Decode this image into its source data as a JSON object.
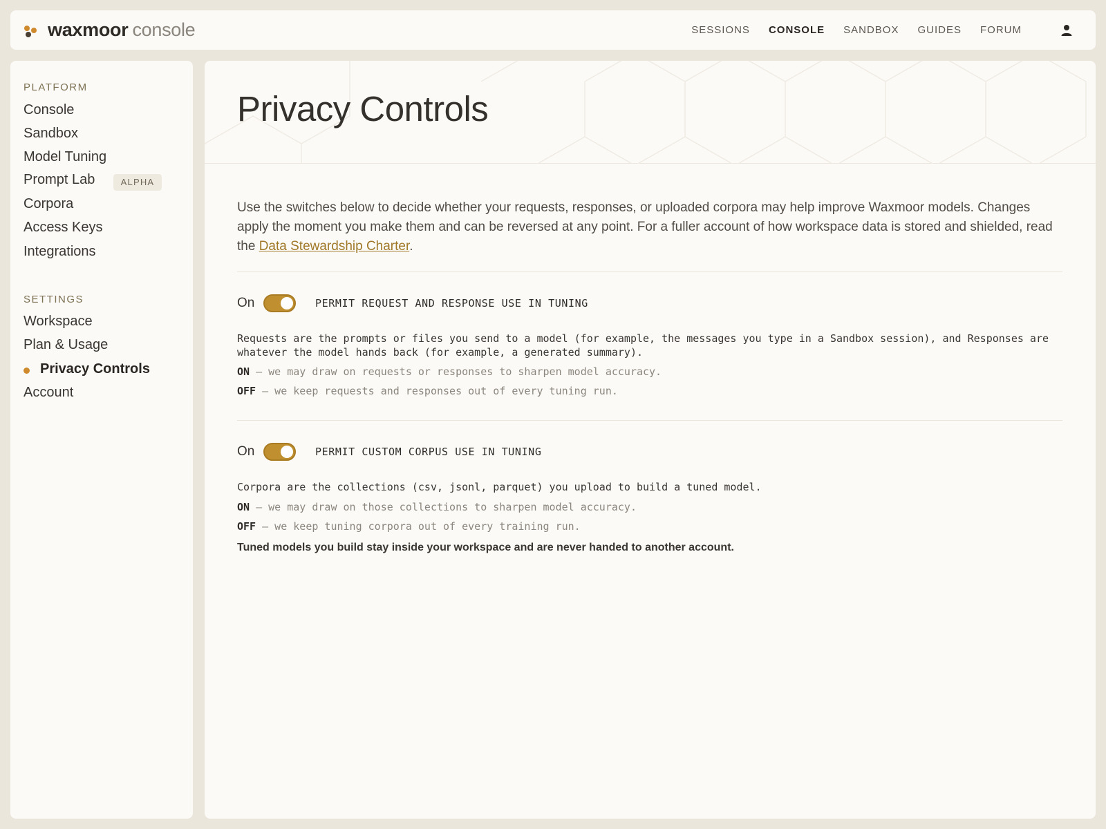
{
  "brand": {
    "name": "waxmoor",
    "suffix": "console"
  },
  "nav": {
    "items": [
      "SESSIONS",
      "CONSOLE",
      "SANDBOX",
      "GUIDES",
      "FORUM"
    ],
    "active": "CONSOLE",
    "user_icon": "user-icon"
  },
  "sidebar": {
    "platform_title": "PLATFORM",
    "platform_items": [
      "Console",
      "Sandbox",
      "Model Tuning",
      "Prompt Lab",
      "Corpora",
      "Access Keys",
      "Integrations"
    ],
    "prompt_lab_badge": "ALPHA",
    "settings_title": "SETTINGS",
    "settings_items": [
      "Workspace",
      "Plan & Usage",
      "Privacy Controls",
      "Account"
    ],
    "active_item": "Privacy Controls"
  },
  "page": {
    "title": "Privacy Controls",
    "intro_text": "Use the switches below to decide whether your requests, responses, or uploaded corpora may help improve Waxmoor models. Changes apply the moment you make them and can be reversed at any point. For a fuller account of how workspace data is stored and shielded, read the ",
    "intro_link": "Data Stewardship Charter",
    "intro_end": "."
  },
  "toggles": [
    {
      "state_label": "On",
      "is_on": true,
      "label": "PERMIT REQUEST AND RESPONSE USE IN TUNING",
      "description": "Requests are the prompts or files you send to a model (for example, the messages you type in a Sandbox session), and Responses are whatever the model hands back (for example, a generated summary).",
      "on_key": "ON",
      "on_text": " — we may draw on requests or responses to sharpen model accuracy.",
      "off_key": "OFF",
      "off_text": " — we keep requests and responses out of every tuning run."
    },
    {
      "state_label": "On",
      "is_on": true,
      "label": "PERMIT CUSTOM CORPUS USE IN TUNING",
      "description": "Corpora are the collections (csv, jsonl, parquet) you upload to build a tuned model.",
      "on_key": "ON",
      "on_text": " — we may draw on those collections to sharpen model accuracy.",
      "off_key": "OFF",
      "off_text": " — we keep tuning corpora out of every training run.",
      "note": "Tuned models you build stay inside your workspace and are never handed to another account."
    }
  ],
  "colors": {
    "accent": "#c09030",
    "active_dot": "#d08a2e",
    "background": "#ebe6dc",
    "panel": "#fbfaf7"
  }
}
